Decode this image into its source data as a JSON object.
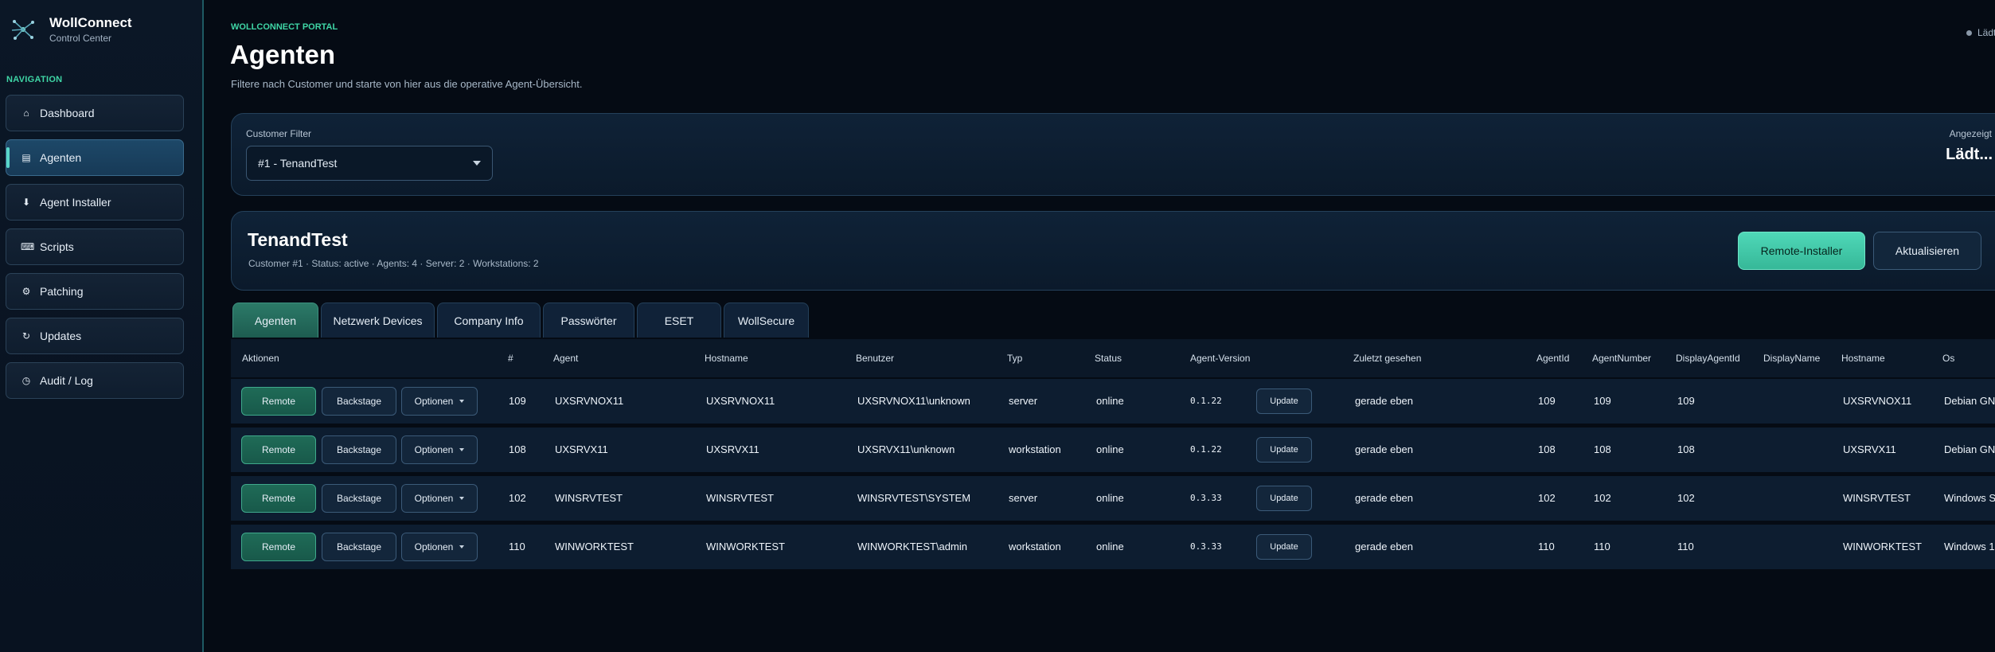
{
  "sidebar": {
    "brand_title": "WollConnect",
    "brand_sub": "Control Center",
    "nav_heading": "NAVIGATION",
    "items": [
      {
        "label": "Dashboard",
        "icon": "home-icon",
        "glyph": "⌂"
      },
      {
        "label": "Agenten",
        "icon": "agents-icon",
        "glyph": "▤"
      },
      {
        "label": "Agent Installer",
        "icon": "download-icon",
        "glyph": "⬇"
      },
      {
        "label": "Scripts",
        "icon": "keyboard-icon",
        "glyph": "⌨"
      },
      {
        "label": "Patching",
        "icon": "gear-icon",
        "glyph": "⚙"
      },
      {
        "label": "Updates",
        "icon": "refresh-icon",
        "glyph": "↻"
      },
      {
        "label": "Audit / Log",
        "icon": "clock-icon",
        "glyph": "◷"
      }
    ]
  },
  "header": {
    "eyebrow": "WOLLCONNECT PORTAL",
    "title": "Agenten",
    "subtitle": "Filtere nach Customer und starte von hier aus die operative Agent-Übersicht.",
    "loading": "Lädt"
  },
  "filter": {
    "label": "Customer Filter",
    "selected": "#1 - TenandTest",
    "shown_label": "Angezeigt",
    "shown_value": "Lädt..."
  },
  "customer": {
    "name": "TenandTest",
    "meta": "Customer #1 · Status: active · Agents: 4 · Server: 2 · Workstations: 2",
    "remote_installer_label": "Remote-Installer",
    "refresh_label": "Aktualisieren"
  },
  "tabs": [
    {
      "label": "Agenten",
      "active": true
    },
    {
      "label": "Netzwerk Devices",
      "active": false
    },
    {
      "label": "Company Info",
      "active": false
    },
    {
      "label": "Passwörter",
      "active": false
    },
    {
      "label": "ESET",
      "active": false
    },
    {
      "label": "WollSecure",
      "active": false
    }
  ],
  "table": {
    "columns": [
      "Aktionen",
      "#",
      "Agent",
      "Hostname",
      "Benutzer",
      "Typ",
      "Status",
      "Agent-Version",
      "Zuletzt gesehen",
      "AgentId",
      "AgentNumber",
      "DisplayAgentId",
      "DisplayName",
      "Hostname",
      "Os"
    ],
    "action_labels": {
      "remote": "Remote",
      "backstage": "Backstage",
      "options": "Optionen",
      "update": "Update"
    },
    "rows": [
      {
        "num": "109",
        "agent": "UXSRVNOX11",
        "hostname": "UXSRVNOX11",
        "user": "UXSRVNOX11\\unknown",
        "type": "server",
        "status": "online",
        "version": "0.1.22",
        "last_seen": "gerade eben",
        "agent_id": "109",
        "agent_number": "109",
        "display_agent_id": "109",
        "display_name": "",
        "hostname2": "UXSRVNOX11",
        "os": "Debian GN"
      },
      {
        "num": "108",
        "agent": "UXSRVX11",
        "hostname": "UXSRVX11",
        "user": "UXSRVX11\\unknown",
        "type": "workstation",
        "status": "online",
        "version": "0.1.22",
        "last_seen": "gerade eben",
        "agent_id": "108",
        "agent_number": "108",
        "display_agent_id": "108",
        "display_name": "",
        "hostname2": "UXSRVX11",
        "os": "Debian GN"
      },
      {
        "num": "102",
        "agent": "WINSRVTEST",
        "hostname": "WINSRVTEST",
        "user": "WINSRVTEST\\SYSTEM",
        "type": "server",
        "status": "online",
        "version": "0.3.33",
        "last_seen": "gerade eben",
        "agent_id": "102",
        "agent_number": "102",
        "display_agent_id": "102",
        "display_name": "",
        "hostname2": "WINSRVTEST",
        "os": "Windows S"
      },
      {
        "num": "110",
        "agent": "WINWORKTEST",
        "hostname": "WINWORKTEST",
        "user": "WINWORKTEST\\admin",
        "type": "workstation",
        "status": "online",
        "version": "0.3.33",
        "last_seen": "gerade eben",
        "agent_id": "110",
        "agent_number": "110",
        "display_agent_id": "110",
        "display_name": "",
        "hostname2": "WINWORKTEST",
        "os": "Windows 1"
      }
    ]
  },
  "colors": {
    "accent": "#3fd6a6",
    "background": "#050b14",
    "panel": "#0f2237",
    "remote_button": "#1f6b57",
    "primary_button": "#4fd8b8"
  }
}
